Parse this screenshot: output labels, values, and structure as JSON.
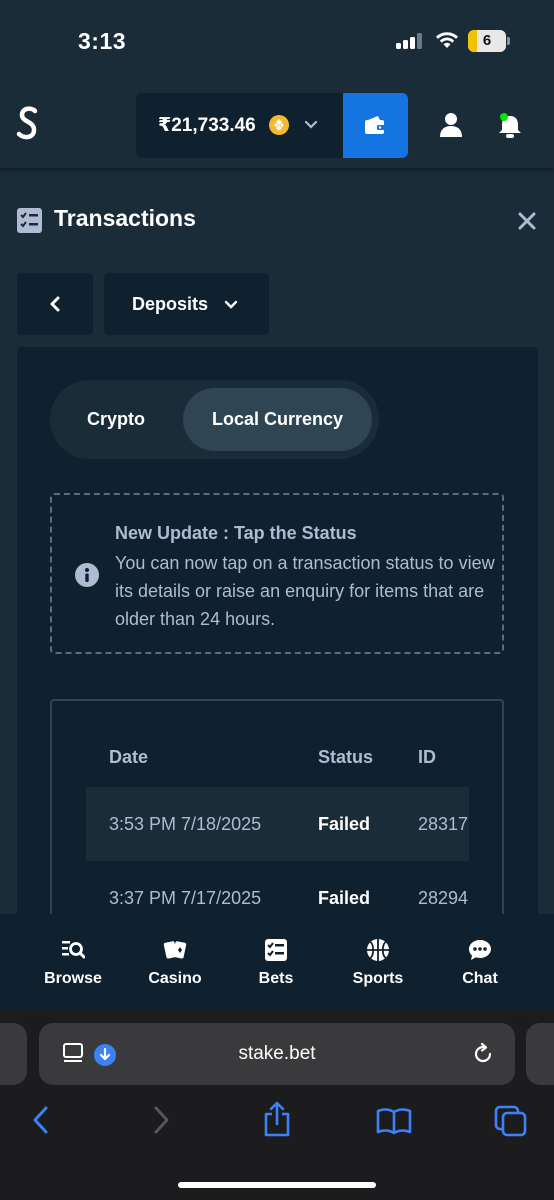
{
  "status_bar": {
    "time": "3:13",
    "battery": "6"
  },
  "header": {
    "balance": "₹21,733.46",
    "icons": {
      "logo": "stake-logo",
      "coin": "bnb-coin-icon",
      "wallet": "wallet-icon",
      "user": "user-icon",
      "bell": "bell-icon"
    },
    "colors": {
      "wallet_button": "#1475e1",
      "coin": "#f3ba2f"
    }
  },
  "page": {
    "title": "Transactions"
  },
  "filters": {
    "type_label": "Deposits"
  },
  "segments": {
    "crypto": "Crypto",
    "local": "Local Currency",
    "selected": "Local Currency"
  },
  "notice": {
    "title": "New Update : Tap the Status",
    "text": "You can now tap on a transaction status to view its details or raise an enquiry for items that are older than 24 hours."
  },
  "table": {
    "headers": {
      "date": "Date",
      "status": "Status",
      "id": "ID"
    },
    "rows": [
      {
        "date": "3:53 PM 7/18/2025",
        "status": "Failed",
        "id": "28317"
      },
      {
        "date": "3:37 PM 7/17/2025",
        "status": "Failed",
        "id": "28294"
      }
    ]
  },
  "bottom_nav": {
    "items": [
      {
        "label": "Browse",
        "icon": "browse-icon"
      },
      {
        "label": "Casino",
        "icon": "casino-cards-icon"
      },
      {
        "label": "Bets",
        "icon": "bets-list-icon"
      },
      {
        "label": "Sports",
        "icon": "basketball-icon"
      },
      {
        "label": "Chat",
        "icon": "chat-bubble-icon"
      }
    ]
  },
  "browser": {
    "url": "stake.bet",
    "accent": "#3b82f6"
  }
}
